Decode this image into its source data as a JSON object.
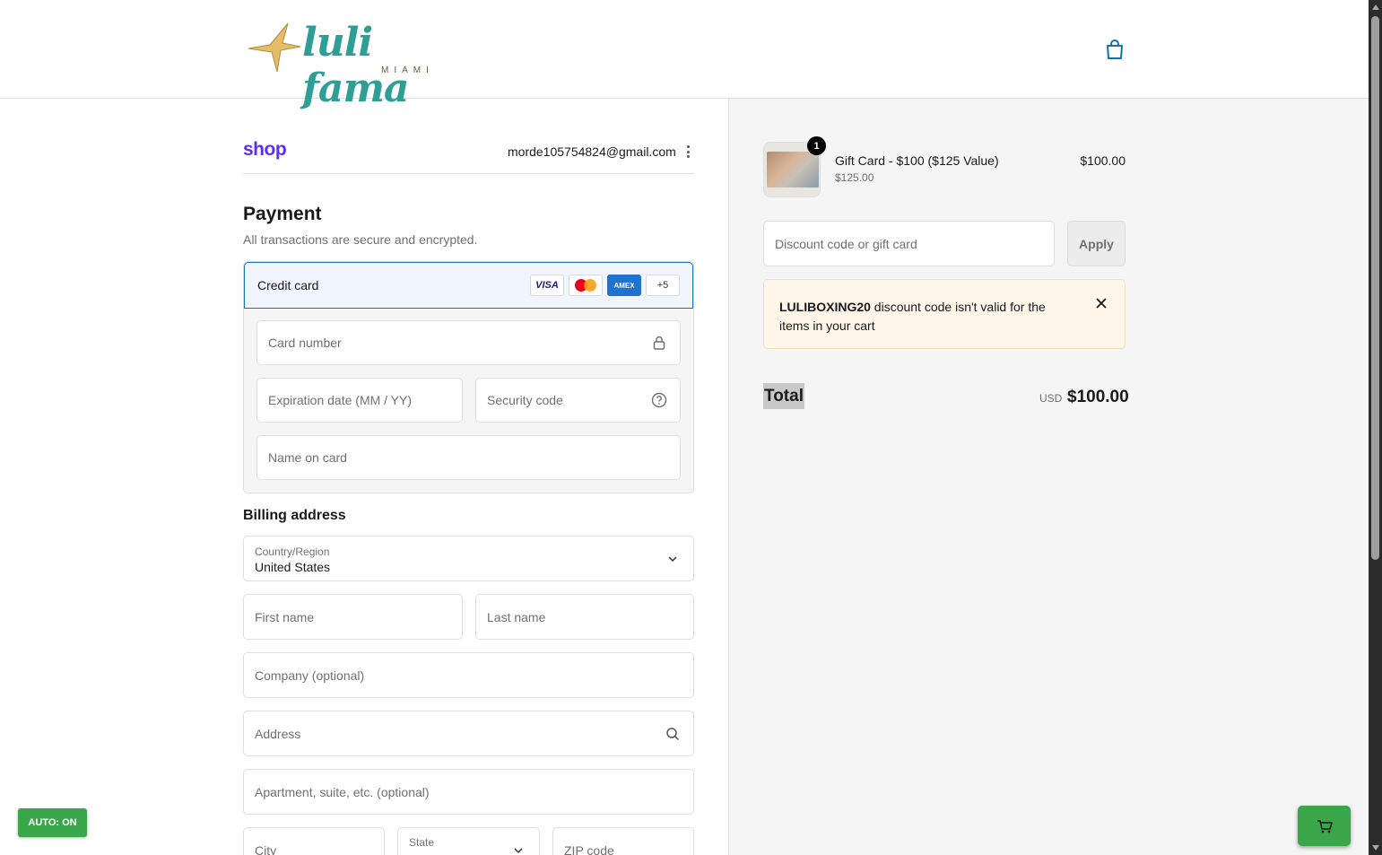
{
  "header": {
    "logo_text": "luli fama",
    "logo_subtext": "MIAMI"
  },
  "shop": {
    "logo": "shop",
    "email": "morde105754824@gmail.com"
  },
  "payment": {
    "title": "Payment",
    "subtitle": "All transactions are secure and encrypted.",
    "method_label": "Credit card",
    "cards": [
      "VISA",
      "AMEX",
      "+5"
    ],
    "card_number_placeholder": "Card number",
    "expiration_placeholder": "Expiration date (MM / YY)",
    "security_placeholder": "Security code",
    "name_placeholder": "Name on card"
  },
  "billing": {
    "title": "Billing address",
    "country_label": "Country/Region",
    "country_value": "United States",
    "first_name": "First name",
    "last_name": "Last name",
    "company": "Company (optional)",
    "address": "Address",
    "apartment": "Apartment, suite, etc. (optional)",
    "city": "City",
    "state_label": "State",
    "zip": "ZIP code"
  },
  "order": {
    "quantity": "1",
    "item_name": "Gift Card - $100 ($125 Value)",
    "item_sub": "$125.00",
    "item_price": "$100.00",
    "discount_placeholder": "Discount code or gift card",
    "apply_label": "Apply",
    "alert_code": "LULIBOXING20",
    "alert_text": " discount code isn't valid for the items in your cart",
    "total_label": "Total",
    "total_currency": "USD",
    "total_value": "$100.00"
  },
  "widgets": {
    "auto_label": "AUTO: ON"
  }
}
